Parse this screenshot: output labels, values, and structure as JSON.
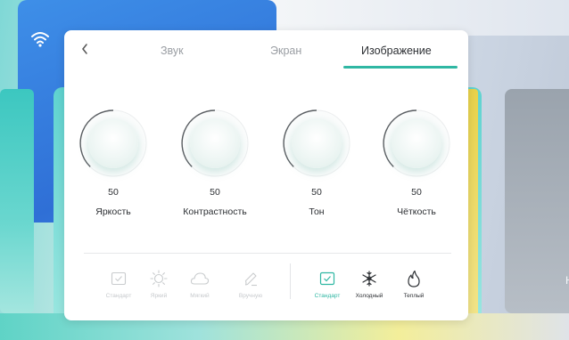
{
  "tabs": [
    {
      "label": "Звук",
      "active": false
    },
    {
      "label": "Экран",
      "active": false
    },
    {
      "label": "Изображение",
      "active": true
    }
  ],
  "accent_color": "#2fb7a3",
  "settings": [
    {
      "value": "50",
      "label": "Яркость"
    },
    {
      "value": "50",
      "label": "Контрастность"
    },
    {
      "value": "50",
      "label": "Тон"
    },
    {
      "value": "50",
      "label": "Чёткость"
    }
  ],
  "picture_modes": [
    {
      "label": "Стандарт",
      "icon": "checkbox-icon",
      "state": "disabled"
    },
    {
      "label": "Яркий",
      "icon": "sun-icon",
      "state": "disabled"
    },
    {
      "label": "Мягкий",
      "icon": "cloud-icon",
      "state": "disabled"
    },
    {
      "label": "Вручную",
      "icon": "pen-icon",
      "state": "disabled"
    }
  ],
  "color_temperature_modes": [
    {
      "label": "Стандарт",
      "icon": "checkbox-icon",
      "state": "selected"
    },
    {
      "label": "Холодный",
      "icon": "snowflake-icon",
      "state": "normal"
    },
    {
      "label": "Теплый",
      "icon": "flame-icon",
      "state": "normal"
    }
  ],
  "background_card_letter": "Н"
}
